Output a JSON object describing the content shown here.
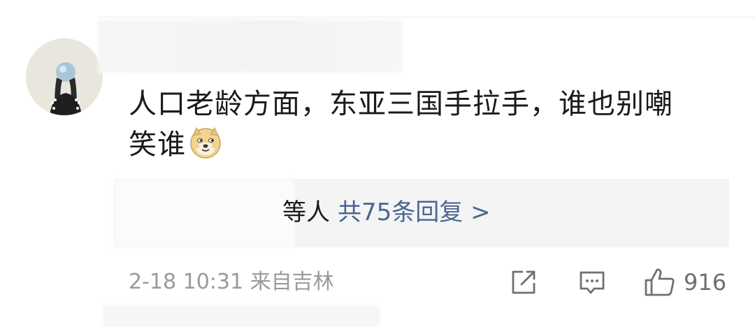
{
  "comment": {
    "text_line1": "人口老龄方面，东亚三国手拉手，谁也别嘲",
    "text_line2": "笑谁",
    "emoji": "doge-emoji"
  },
  "replies": {
    "visible_tail": "等人",
    "link_label": "共75条回复 >"
  },
  "meta": {
    "time": "2-18 10:31",
    "source": "来自吉林"
  },
  "actions": {
    "share_icon": "share-icon",
    "comment_icon": "comment-icon",
    "like_icon": "thumbs-up-icon",
    "like_count": "916"
  },
  "colors": {
    "link": "#49678e",
    "text": "#1a1a1a",
    "meta": "#9a9a9a",
    "reply_bg": "#f4f4f5"
  }
}
